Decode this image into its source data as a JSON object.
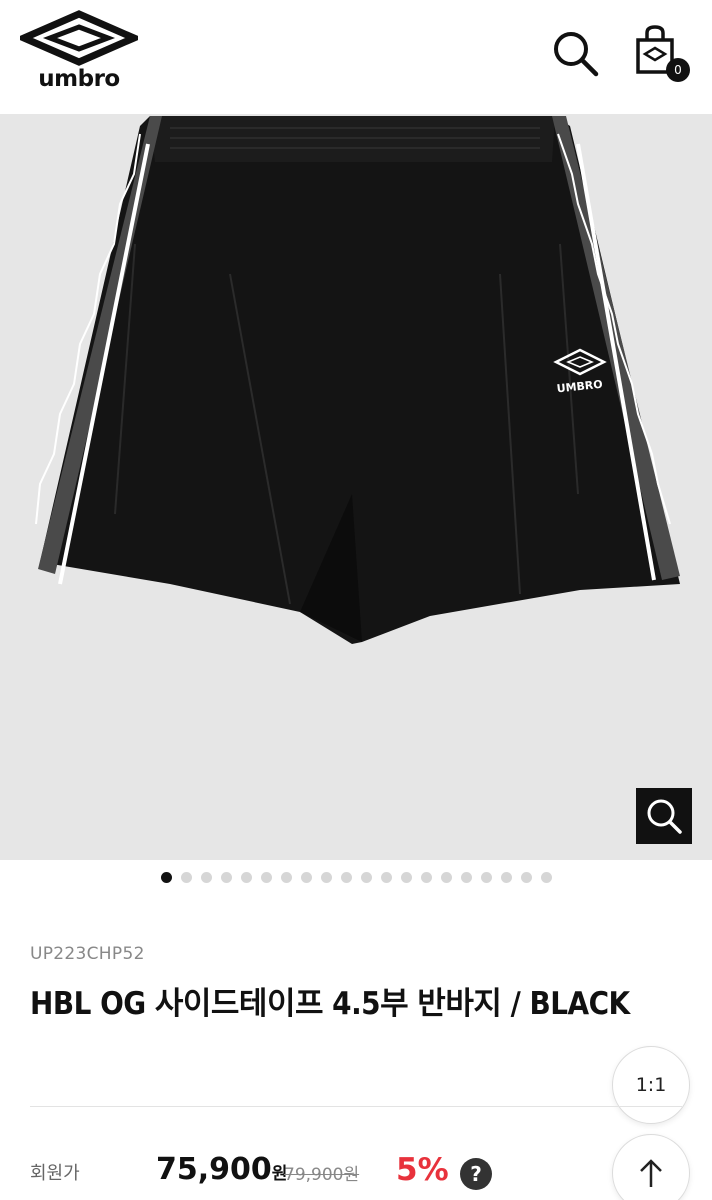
{
  "header": {
    "brand": "umbro",
    "cart_count": "0"
  },
  "gallery": {
    "image_count": 20,
    "active_index": 0
  },
  "product": {
    "sku": "UP223CHP52",
    "title": "HBL OG 사이드테이프 4.5부 반바지 / BLACK",
    "member_price_label": "회원가",
    "price": "75,900",
    "price_unit": "원",
    "original_price": "79,900원",
    "discount": "5%",
    "help": "?"
  },
  "floating": {
    "ratio_label": "1:1"
  },
  "icons": {
    "logo": "umbro-diamond-logo",
    "search": "search-icon",
    "cart": "shopping-bag-icon",
    "zoom": "zoom-icon",
    "top": "arrow-up-icon"
  }
}
